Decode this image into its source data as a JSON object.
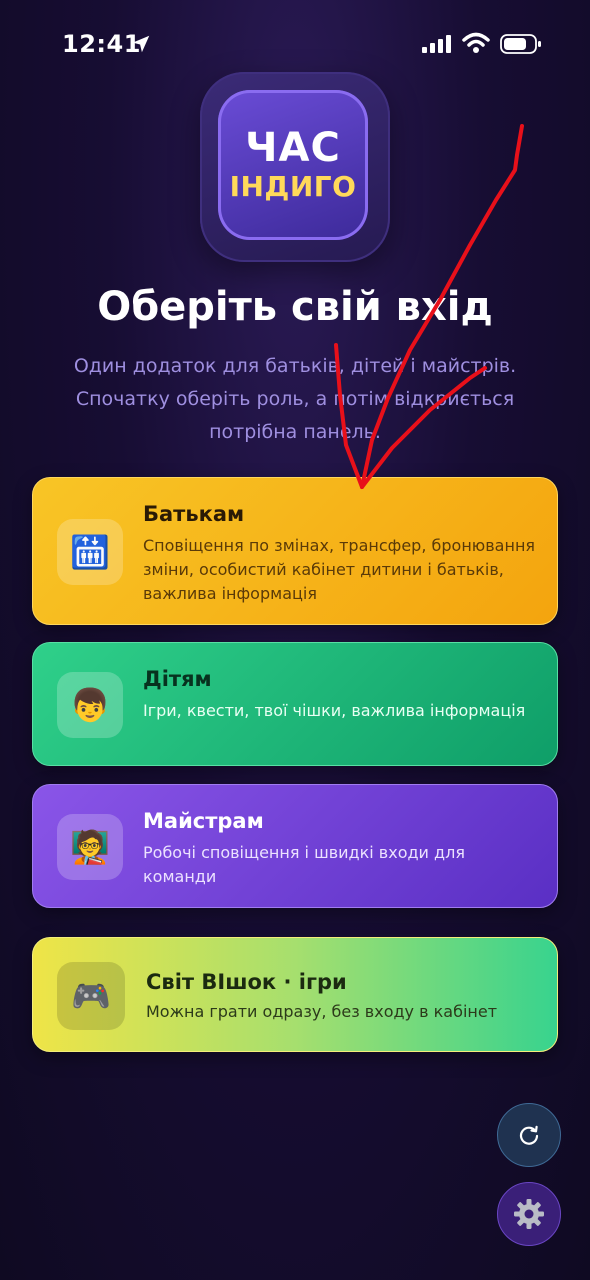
{
  "status_bar": {
    "time": "12:41",
    "icons": [
      "location-arrow-icon",
      "cellular-signal-icon",
      "wifi-icon",
      "battery-icon"
    ]
  },
  "logo": {
    "line1": "ЧАС",
    "line2": "ІНДИГО"
  },
  "header": {
    "title": "Оберіть свій вхід",
    "subtitle": "Один додаток для батьків, дітей і майстрів. Спочатку оберіть роль, а потім відкриється потрібна панель."
  },
  "cards": [
    {
      "title": "Батькам",
      "description": "Сповіщення по змінах, трансфер, бронювання зміни, особистий кабінет дитини і батьків, важлива інформація",
      "icon": "family-icon",
      "icon_glyph": "🛗",
      "color": "#f6b81c"
    },
    {
      "title": "Дітям",
      "description": "Ігри, квести, твої чішки, важлива інформація",
      "icon": "child-icon",
      "icon_glyph": "👦",
      "color": "#1fb97a"
    },
    {
      "title": "Майстрам",
      "description": "Робочі сповіщення і швидкі входи для команди",
      "icon": "teacher-icon",
      "icon_glyph": "🧑‍🏫",
      "color": "#7446d8"
    },
    {
      "title": "Світ ВІшок · ігри",
      "description": "Можна грати одразу, без входу в кабінет",
      "icon": "gamepad-icon",
      "icon_glyph": "🎮",
      "color": "#a6df6e"
    }
  ],
  "floating_buttons": {
    "refresh": "refresh-icon",
    "settings": "gear-icon"
  },
  "colors": {
    "background": "#170d33",
    "subtitle": "#9f8fe0",
    "annotation": "#e8101a"
  }
}
